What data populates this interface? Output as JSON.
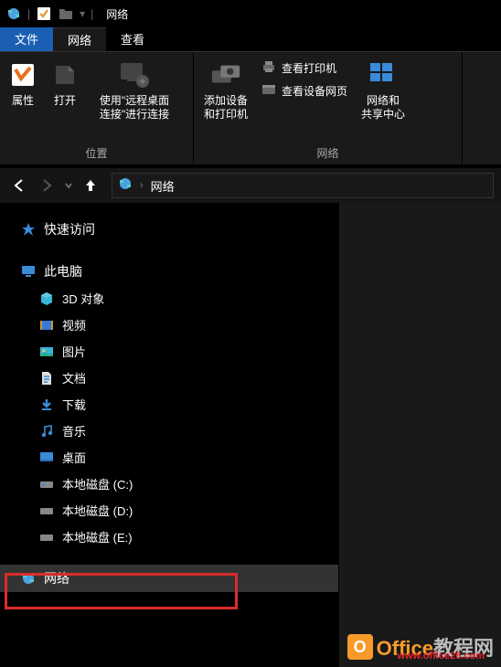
{
  "titlebar": {
    "title": "网络"
  },
  "menu": {
    "file": "文件",
    "network": "网络",
    "view": "查看"
  },
  "ribbon": {
    "group1_label": "位置",
    "group2_label": "网络",
    "properties": "属性",
    "open": "打开",
    "rdc": "使用\"远程桌面\n连接\"进行连接",
    "add_dev": "添加设备\n和打印机",
    "view_printer": "查看打印机",
    "view_device_webpage": "查看设备网页",
    "netshare": "网络和\n共享中心"
  },
  "nav": {
    "crumb": "网络"
  },
  "tree": {
    "quick_access": "快速访问",
    "this_pc": "此电脑",
    "objects3d": "3D 对象",
    "videos": "视频",
    "pictures": "图片",
    "documents": "文档",
    "downloads": "下载",
    "music": "音乐",
    "desktop": "桌面",
    "disk_c": "本地磁盘 (C:)",
    "disk_d": "本地磁盘 (D:)",
    "disk_e": "本地磁盘 (E:)",
    "network": "网络"
  },
  "watermark": {
    "brand": "Office",
    "suffix": "教程网",
    "url": "www.office26.com"
  }
}
